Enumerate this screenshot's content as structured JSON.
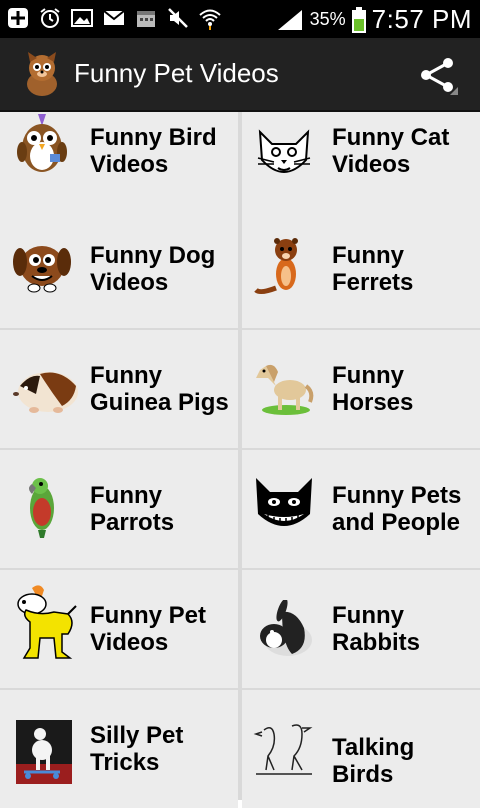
{
  "status_bar": {
    "battery_percent": "35%",
    "time": "7:57 PM",
    "icons": [
      "add-icon",
      "alarm-icon",
      "image-icon",
      "email-icon",
      "calendar-icon",
      "mute-icon",
      "wifi-icon",
      "signal-icon",
      "battery-icon"
    ]
  },
  "action_bar": {
    "title": "Funny Pet Videos",
    "share_icon": "share-icon"
  },
  "tiles": [
    {
      "label": "Funny Bird\nVideos",
      "icon": "bird-icon"
    },
    {
      "label": "Funny Cat\nVideos",
      "icon": "cat-icon"
    },
    {
      "label": "Funny Dog\nVideos",
      "icon": "dog-icon"
    },
    {
      "label": "Funny\nFerrets",
      "icon": "ferret-icon"
    },
    {
      "label": "Funny\nGuinea Pigs",
      "icon": "guinea-pig-icon"
    },
    {
      "label": "Funny\nHorses",
      "icon": "horse-icon"
    },
    {
      "label": "Funny\nParrots",
      "icon": "parrot-icon"
    },
    {
      "label": "Funny Pets\nand People",
      "icon": "black-cat-icon"
    },
    {
      "label": "Funny Pet\nVideos",
      "icon": "yellow-dog-icon"
    },
    {
      "label": "Funny\nRabbits",
      "icon": "rabbit-icon"
    },
    {
      "label": "Silly Pet\nTricks",
      "icon": "poodle-icon"
    },
    {
      "label": "Talking Birds",
      "icon": "birds-sketch-icon"
    }
  ]
}
